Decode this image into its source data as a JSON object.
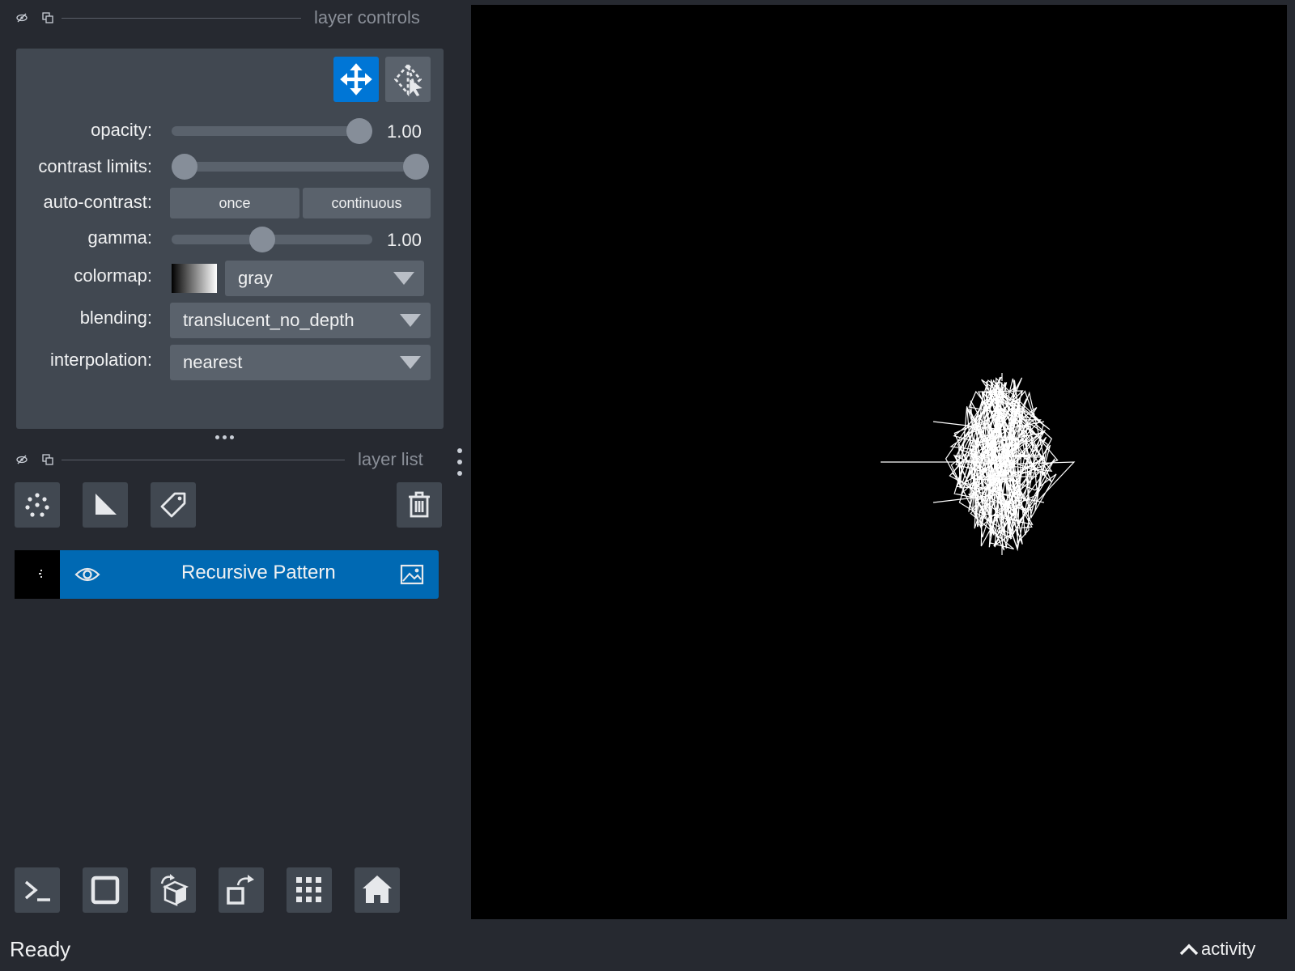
{
  "layer_controls": {
    "title": "layer controls",
    "rows": {
      "opacity": {
        "label": "opacity:",
        "value": "1.00",
        "level": 1.0
      },
      "contrast_limits": {
        "label": "contrast limits:",
        "low": 0.0,
        "high": 1.0
      },
      "auto_contrast": {
        "label": "auto-contrast:",
        "once": "once",
        "continuous": "continuous"
      },
      "gamma": {
        "label": "gamma:",
        "value": "1.00",
        "level": 0.45
      },
      "colormap": {
        "label": "colormap:",
        "value": "gray"
      },
      "blending": {
        "label": "blending:",
        "value": "translucent_no_depth"
      },
      "interpolation": {
        "label": "interpolation:",
        "value": "nearest"
      }
    },
    "modes": [
      "move-icon",
      "select-icon"
    ],
    "accent_color": "#0076d6"
  },
  "layer_list": {
    "title": "layer list",
    "tools": [
      "points-icon",
      "shapes-icon",
      "labels-icon",
      "trash-icon"
    ],
    "layers": [
      {
        "name": "Recursive Pattern",
        "visible": true,
        "type_icon": "image-icon"
      }
    ],
    "selected_color": "#0069b3"
  },
  "bottom_toolbar": [
    "console-icon",
    "ndisplay-icon",
    "roll-icon",
    "transpose-icon",
    "grid-icon",
    "home-icon"
  ],
  "status": {
    "text": "Ready",
    "activity": "activity"
  }
}
